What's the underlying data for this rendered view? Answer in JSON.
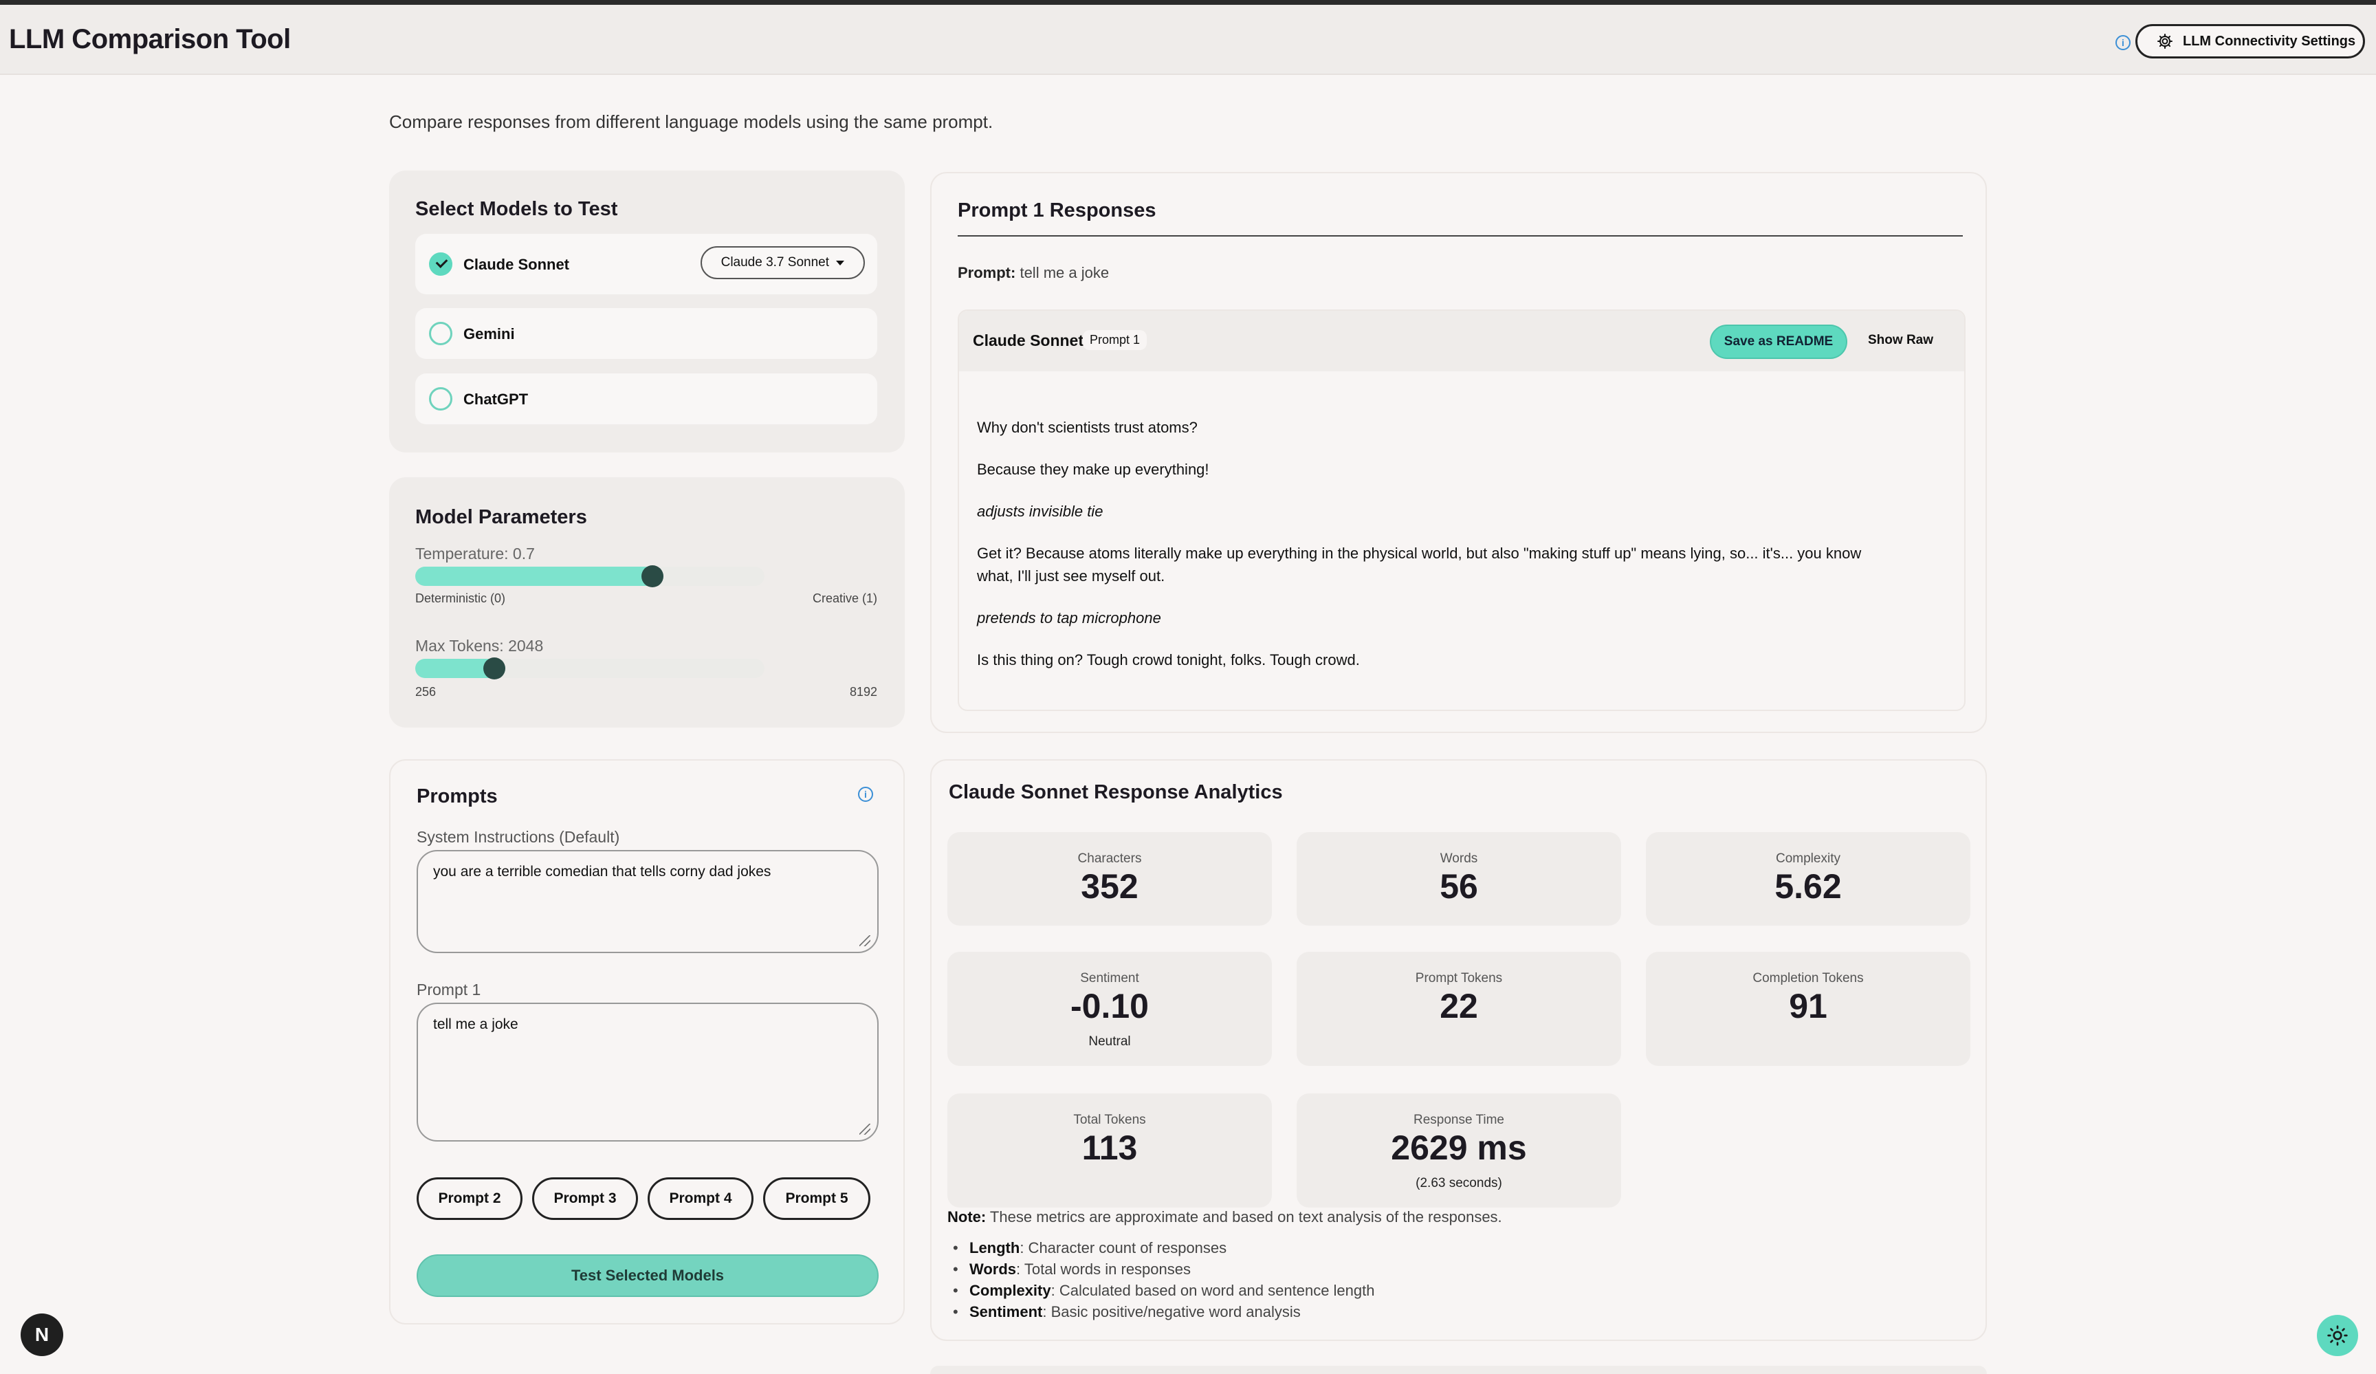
{
  "header": {
    "title": "LLM Comparison Tool",
    "settings_label": "LLM Connectivity Settings"
  },
  "subtitle": "Compare responses from different language models using the same prompt.",
  "models": {
    "title": "Select Models to Test",
    "items": [
      {
        "label": "Claude Sonnet",
        "checked": true,
        "version": "Claude 3.7 Sonnet"
      },
      {
        "label": "Gemini",
        "checked": false
      },
      {
        "label": "ChatGPT",
        "checked": false
      }
    ]
  },
  "parameters": {
    "title": "Model Parameters",
    "temperature": {
      "label": "Temperature: 0.7",
      "value": 0.7,
      "min_label": "Deterministic (0)",
      "max_label": "Creative (1)"
    },
    "max_tokens": {
      "label": "Max Tokens: 2048",
      "value": 2048,
      "min": 256,
      "max": 8192,
      "min_label": "256",
      "max_label": "8192"
    }
  },
  "prompts": {
    "title": "Prompts",
    "system_label": "System Instructions (Default)",
    "system_value": "you are a terrible comedian that tells corny dad jokes",
    "prompt1_label": "Prompt 1",
    "prompt1_value": "tell me a joke",
    "buttons": [
      "Prompt 2",
      "Prompt 3",
      "Prompt 4",
      "Prompt 5"
    ],
    "test_button": "Test Selected Models"
  },
  "responses": {
    "title": "Prompt 1 Responses",
    "prompt_prefix": "Prompt:",
    "prompt_text": "tell me a joke",
    "model": "Claude Sonnet",
    "tag": "Prompt 1",
    "save_button": "Save as README",
    "raw_button": "Show Raw",
    "lines": [
      "Why don't scientists trust atoms?",
      "Because they make up everything!",
      "adjusts invisible tie",
      "Get it? Because atoms literally make up everything in the physical world, but also \"making stuff up\" means lying, so... it's... you know",
      "what, I'll just see myself out.",
      "pretends to tap microphone",
      "Is this thing on? Tough crowd tonight, folks. Tough crowd."
    ]
  },
  "analytics": {
    "title": "Claude Sonnet Response Analytics",
    "metrics": [
      {
        "label": "Characters",
        "value": "352"
      },
      {
        "label": "Words",
        "value": "56"
      },
      {
        "label": "Complexity",
        "value": "5.62"
      },
      {
        "label": "Sentiment",
        "value": "-0.10",
        "sub": "Neutral"
      },
      {
        "label": "Prompt Tokens",
        "value": "22"
      },
      {
        "label": "Completion Tokens",
        "value": "91"
      },
      {
        "label": "Total Tokens",
        "value": "113"
      },
      {
        "label": "Response Time",
        "value": "2629 ms",
        "sub": "(2.63 seconds)"
      }
    ],
    "note_label": "Note:",
    "note_text": " These metrics are approximate and based on text analysis of the responses.",
    "bullets": [
      {
        "term": "Length",
        "desc": ": Character count of responses"
      },
      {
        "term": "Words",
        "desc": ": Total words in responses"
      },
      {
        "term": "Complexity",
        "desc": ": Calculated based on word and sentence length"
      },
      {
        "term": "Sentiment",
        "desc": ": Basic positive/negative word analysis"
      }
    ]
  },
  "footer": {
    "badge": "N"
  },
  "colors": {
    "accent": "#5ed9bf",
    "slider_fill": "#7de3cd",
    "thumb": "#2a4b45",
    "info": "#3b8fd6"
  }
}
